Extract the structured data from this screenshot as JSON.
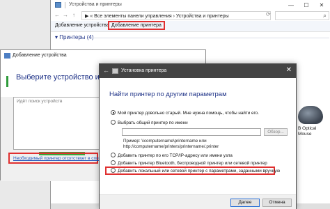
{
  "explorer": {
    "title": "Устройства и принтеры",
    "minimize": "—",
    "maximize": "☐",
    "close": "✕",
    "nav_back": "←",
    "nav_forward": "→",
    "nav_up": "↑",
    "address_path": "▶  «  Все элементы панели управления  ›  Устройства и принтеры",
    "refresh": "⟳",
    "search_placeholder": "",
    "search_icon": "⌕",
    "toolbar": {
      "add_device": "Добавление устройства",
      "add_printer": "Добавление принтера"
    },
    "group_label": "▾ Принтеры (4)"
  },
  "add_device": {
    "title": "Добавление устройства",
    "heading": "Выберите устройство или принтер",
    "list_placeholder": "Идёт поиск устройств",
    "progress": 0.8,
    "not_listed_link": "Необходимый принтер отсутствует в списке"
  },
  "side_device": {
    "label_line1": "B Optical",
    "label_line2": "Mouse"
  },
  "printer_dialog": {
    "title": "Установка принтера",
    "back_icon": "←",
    "close_icon": "✕",
    "heading": "Найти принтер по другим параметрам",
    "options": [
      {
        "label": "Мой принтер довольно старый. Мне нужна помощь, чтобы найти его.",
        "selected": true
      },
      {
        "label": "Выбрать общий принтер по имени",
        "selected": false
      },
      {
        "label": "Добавить принтер по его TCP/IP-адресу или имени узла",
        "selected": false
      },
      {
        "label": "Добавить принтер Bluetooth, беспроводной принтер или сетевой принтер",
        "selected": false
      },
      {
        "label": "Добавить локальный или сетевой принтер с параметрами, заданными вручную",
        "selected": false
      }
    ],
    "browse_button": "Обзор...",
    "hint_line1": "Пример: \\\\computername\\printername или",
    "hint_line2": "http://computername/printers/printername/.printer",
    "next_button": "Далее",
    "cancel_button": "Отмена"
  },
  "colors": {
    "heading_blue": "#1e3287",
    "highlight_red": "#e03030",
    "progress_green": "#36a83b",
    "link_blue": "#2255bb"
  }
}
